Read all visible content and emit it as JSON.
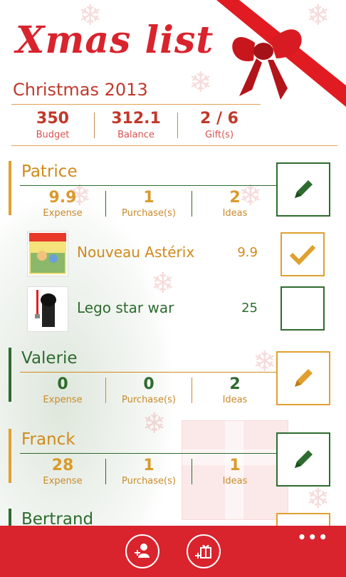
{
  "app": {
    "title": "Xmas list"
  },
  "list": {
    "name": "Christmas 2013"
  },
  "summary": {
    "budget": {
      "value": "350",
      "label": "Budget"
    },
    "balance": {
      "value": "312.1",
      "label": "Balance"
    },
    "gifts": {
      "value": "2 / 6",
      "label": "Gift(s)"
    }
  },
  "people": [
    {
      "name": "Patrice",
      "expense": "9.9",
      "expense_label": "Expense",
      "purchases": "1",
      "purchases_label": "Purchase(s)",
      "ideas": "2",
      "ideas_label": "Ideas",
      "gifts": [
        {
          "name": "Nouveau Astérix",
          "price": "9.9",
          "checked": true
        },
        {
          "name": "Lego star war",
          "price": "25",
          "checked": false
        }
      ]
    },
    {
      "name": "Valerie",
      "expense": "0",
      "expense_label": "Expense",
      "purchases": "0",
      "purchases_label": "Purchase(s)",
      "ideas": "2",
      "ideas_label": "Ideas"
    },
    {
      "name": "Franck",
      "expense": "28",
      "expense_label": "Expense",
      "purchases": "1",
      "purchases_label": "Purchase(s)",
      "ideas": "1",
      "ideas_label": "Ideas"
    },
    {
      "name": "Bertrand"
    }
  ],
  "appbar": {
    "more": "•••"
  },
  "colors": {
    "red": "#d9232d",
    "green": "#2e6b2e",
    "orange": "#e0a030"
  },
  "icons": [
    "pencil-icon",
    "checkmark-icon",
    "add-person-icon",
    "add-gift-icon",
    "more-icon"
  ]
}
